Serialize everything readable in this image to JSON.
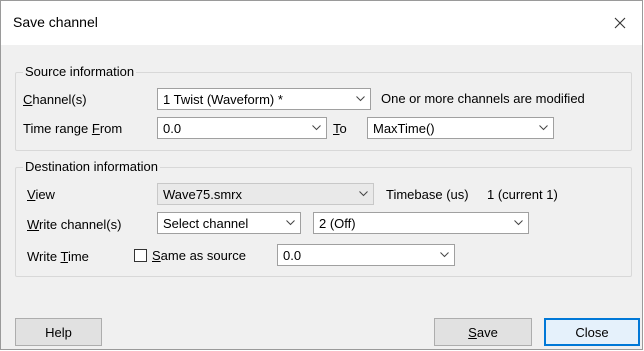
{
  "window": {
    "title": "Save channel",
    "close_icon": "close-icon"
  },
  "source": {
    "group_label": "Source information",
    "channel_label_u": "C",
    "channel_label_rest": "hannel(s)",
    "channel_value": "1 Twist (Waveform) *",
    "modified_note": "One or more channels are modified",
    "time_range_label_pre": "Time range ",
    "time_range_label_u": "F",
    "time_range_label_post": "rom",
    "from_value": "0.0",
    "to_label_u": "T",
    "to_label_rest": "o",
    "to_value": "MaxTime()"
  },
  "destination": {
    "group_label": "Destination information",
    "view_label_u": "V",
    "view_label_rest": "iew",
    "view_value": "Wave75.smrx",
    "timebase_label": "Timebase (us)",
    "timebase_value": "1 (current 1)",
    "write_channel_label_u": "W",
    "write_channel_label_rest": "rite channel(s)",
    "write_channel_mode": "Select channel",
    "write_channel_value": "2 (Off)",
    "write_time_label_pre": "Write ",
    "write_time_label_u": "T",
    "write_time_label_post": "ime",
    "same_as_source_u": "S",
    "same_as_source_rest": "ame as source",
    "same_as_source_checked": false,
    "write_time_value": "0.0"
  },
  "buttons": {
    "help": "Help",
    "save_u": "S",
    "save_rest": "ave",
    "close": "Close"
  }
}
